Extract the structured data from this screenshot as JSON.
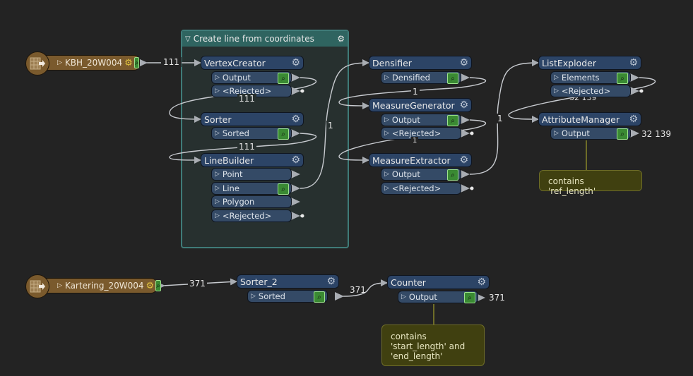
{
  "bookmark": {
    "title": "Create line from coordinates",
    "collapse_icon": "triangle-down-icon",
    "settings_icon": "gear-icon"
  },
  "readers": [
    {
      "name": "KBH_20W004",
      "features": "111",
      "icon": "table-reader-icon"
    },
    {
      "name": "Kartering_20W004",
      "features": "371",
      "icon": "table-reader-icon"
    }
  ],
  "transformers": {
    "vertexcreator": {
      "name": "VertexCreator",
      "ports": [
        "Output",
        "<Rejected>"
      ]
    },
    "sorter": {
      "name": "Sorter",
      "ports": [
        "Sorted"
      ]
    },
    "linebuilder": {
      "name": "LineBuilder",
      "ports": [
        "Point",
        "Line",
        "Polygon",
        "<Rejected>"
      ]
    },
    "densifier": {
      "name": "Densifier",
      "ports": [
        "Densified"
      ]
    },
    "measuregenerator": {
      "name": "MeasureGenerator",
      "ports": [
        "Output",
        "<Rejected>"
      ]
    },
    "measureextractor": {
      "name": "MeasureExtractor",
      "ports": [
        "Output",
        "<Rejected>"
      ]
    },
    "listexploder": {
      "name": "ListExploder",
      "ports": [
        "Elements",
        "<Rejected>"
      ]
    },
    "attributemanager": {
      "name": "AttributeManager",
      "ports": [
        "Output"
      ]
    },
    "sorter2": {
      "name": "Sorter_2",
      "ports": [
        "Sorted"
      ]
    },
    "counter": {
      "name": "Counter",
      "ports": [
        "Output"
      ]
    }
  },
  "connection_counts": {
    "kbh_to_vertexcreator": "111",
    "vertexcreator_to_sorter": "111",
    "sorter_to_linebuilder": "111",
    "linebuilder_to_densifier": "1",
    "densifier_to_measuregenerator": "1",
    "measuregenerator_to_measureextractor": "1",
    "measureextractor_to_listexploder": "1",
    "listexploder_to_attributemanager": "32 139",
    "attributemanager_output": "32 139",
    "kartering_to_sorter2": "371",
    "sorter2_to_counter": "371",
    "counter_output": "371"
  },
  "annotations": {
    "attributemanager_note": "contains 'ref_length'",
    "counter_note_lines": [
      "contains",
      "'start_length' and",
      "'end_length'"
    ]
  },
  "colors": {
    "canvas": "#232323",
    "bookmark": "#2f6460",
    "transformer": "#2c4466",
    "reader": "#7a5a2d",
    "inspector": "#3a8a33",
    "annotation": "#404010"
  }
}
